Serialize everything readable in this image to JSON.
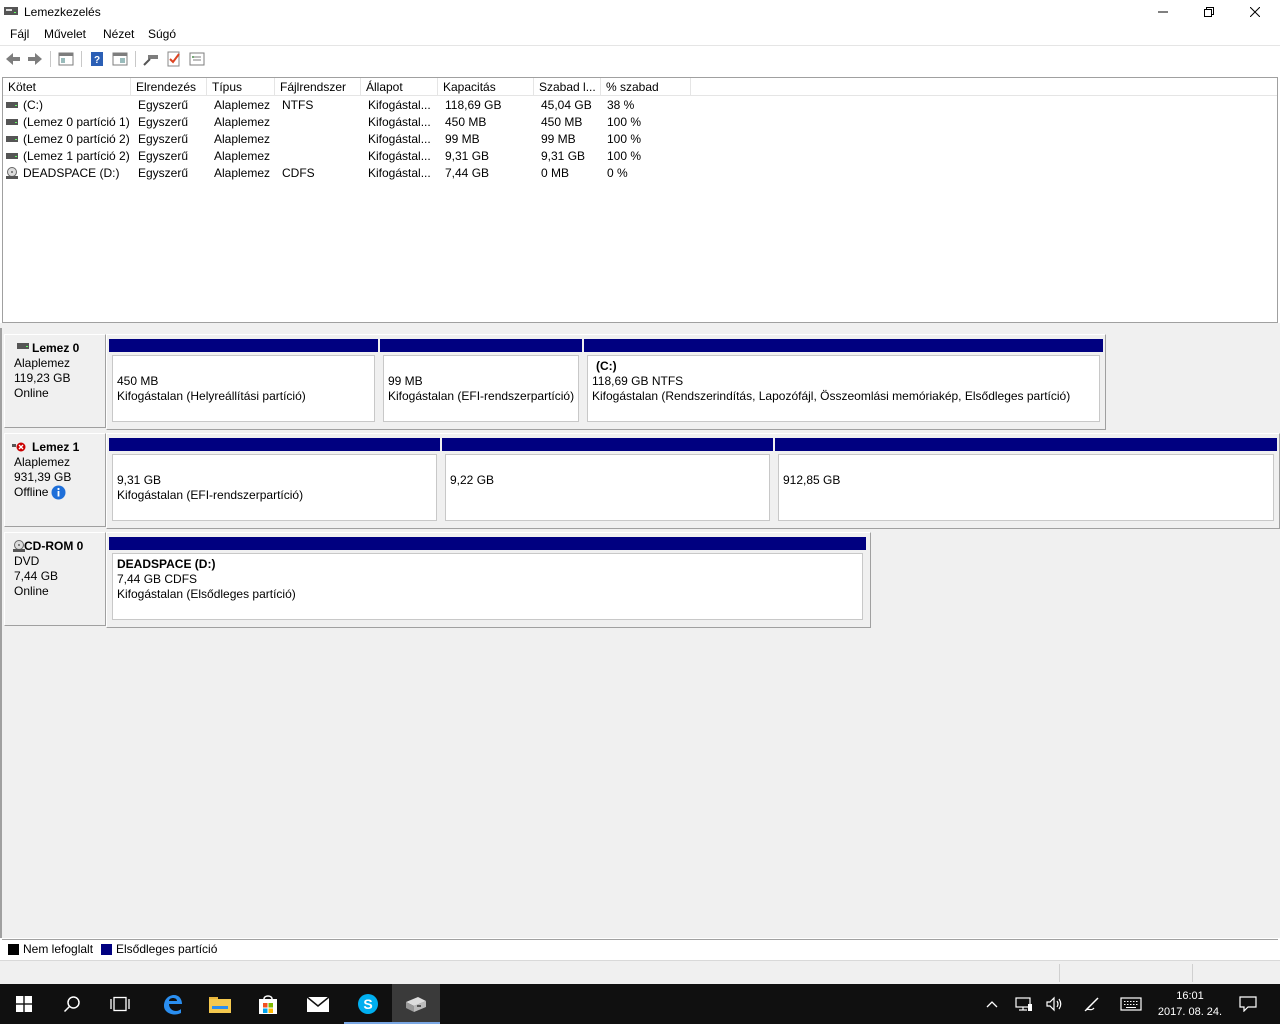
{
  "window": {
    "title": "Lemezkezelés"
  },
  "menu": [
    "Fájl",
    "Művelet",
    "Nézet",
    "Súgó"
  ],
  "toolbar_icons": [
    "back-arrow-icon",
    "forward-arrow-icon",
    "console-tree-icon",
    "help-icon",
    "properties-icon",
    "connect-icon",
    "check-icon",
    "settings-list-icon"
  ],
  "volume_table": {
    "headers": [
      "Kötet",
      "Elrendezés",
      "Típus",
      "Fájlrendszer",
      "Állapot",
      "Kapacitás",
      "Szabad l...",
      "% szabad"
    ],
    "rows": [
      {
        "icon": "drive-icon",
        "volume": " (C:)",
        "layout": "Egyszerű",
        "type": "Alaplemez",
        "fs": "NTFS",
        "status": "Kifogástal...",
        "capacity": "118,69 GB",
        "free": "45,04 GB",
        "pct": "38 %"
      },
      {
        "icon": "drive-icon",
        "volume": "(Lemez 0 partíció 1)",
        "layout": "Egyszerű",
        "type": "Alaplemez",
        "fs": "",
        "status": "Kifogástal...",
        "capacity": "450 MB",
        "free": "450 MB",
        "pct": "100 %"
      },
      {
        "icon": "drive-icon",
        "volume": "(Lemez 0 partíció 2)",
        "layout": "Egyszerű",
        "type": "Alaplemez",
        "fs": "",
        "status": "Kifogástal...",
        "capacity": "99 MB",
        "free": "99 MB",
        "pct": "100 %"
      },
      {
        "icon": "drive-icon",
        "volume": "(Lemez 1 partíció 2)",
        "layout": "Egyszerű",
        "type": "Alaplemez",
        "fs": "",
        "status": "Kifogástal...",
        "capacity": "9,31 GB",
        "free": "9,31 GB",
        "pct": "100 %"
      },
      {
        "icon": "cd-drive-icon",
        "volume": "DEADSPACE (D:)",
        "layout": "Egyszerű",
        "type": "Alaplemez",
        "fs": "CDFS",
        "status": "Kifogástal...",
        "capacity": "7,44 GB",
        "free": "0 MB",
        "pct": "0 %"
      }
    ]
  },
  "disks": [
    {
      "name": "Lemez 0",
      "kind": "Alaplemez",
      "size": "119,23 GB",
      "state": "Online",
      "partitions": [
        {
          "title": "",
          "size": "450 MB",
          "status": "Kifogástalan (Helyreállítási partíció)"
        },
        {
          "title": "",
          "size": "99 MB",
          "status": "Kifogástalan (EFI-rendszerpartíció)"
        },
        {
          "title": "(C:)",
          "size": "118,69 GB NTFS",
          "status": "Kifogástalan (Rendszerindítás, Lapozófájl, Összeomlási memóriakép, Elsődleges partíció)"
        }
      ]
    },
    {
      "name": "Lemez 1",
      "kind": "Alaplemez",
      "size": "931,39 GB",
      "state": "Offline",
      "partitions": [
        {
          "title": "",
          "size": "9,31 GB",
          "status": "Kifogástalan (EFI-rendszerpartíció)"
        },
        {
          "title": "",
          "size": "9,22 GB",
          "status": ""
        },
        {
          "title": "",
          "size": "912,85 GB",
          "status": ""
        }
      ]
    },
    {
      "name": "CD-ROM 0",
      "kind": "DVD",
      "size": "7,44 GB",
      "state": "Online",
      "partitions": [
        {
          "title": "DEADSPACE  (D:)",
          "size": "7,44 GB CDFS",
          "status": "Kifogástalan (Elsődleges partíció)"
        }
      ]
    }
  ],
  "legend": [
    {
      "label": "Nem lefoglalt",
      "color": "#000000"
    },
    {
      "label": "Elsődleges partíció",
      "color": "#000080"
    }
  ],
  "taskbar": {
    "clock_time": "16:01",
    "clock_date": "2017. 08. 24."
  }
}
